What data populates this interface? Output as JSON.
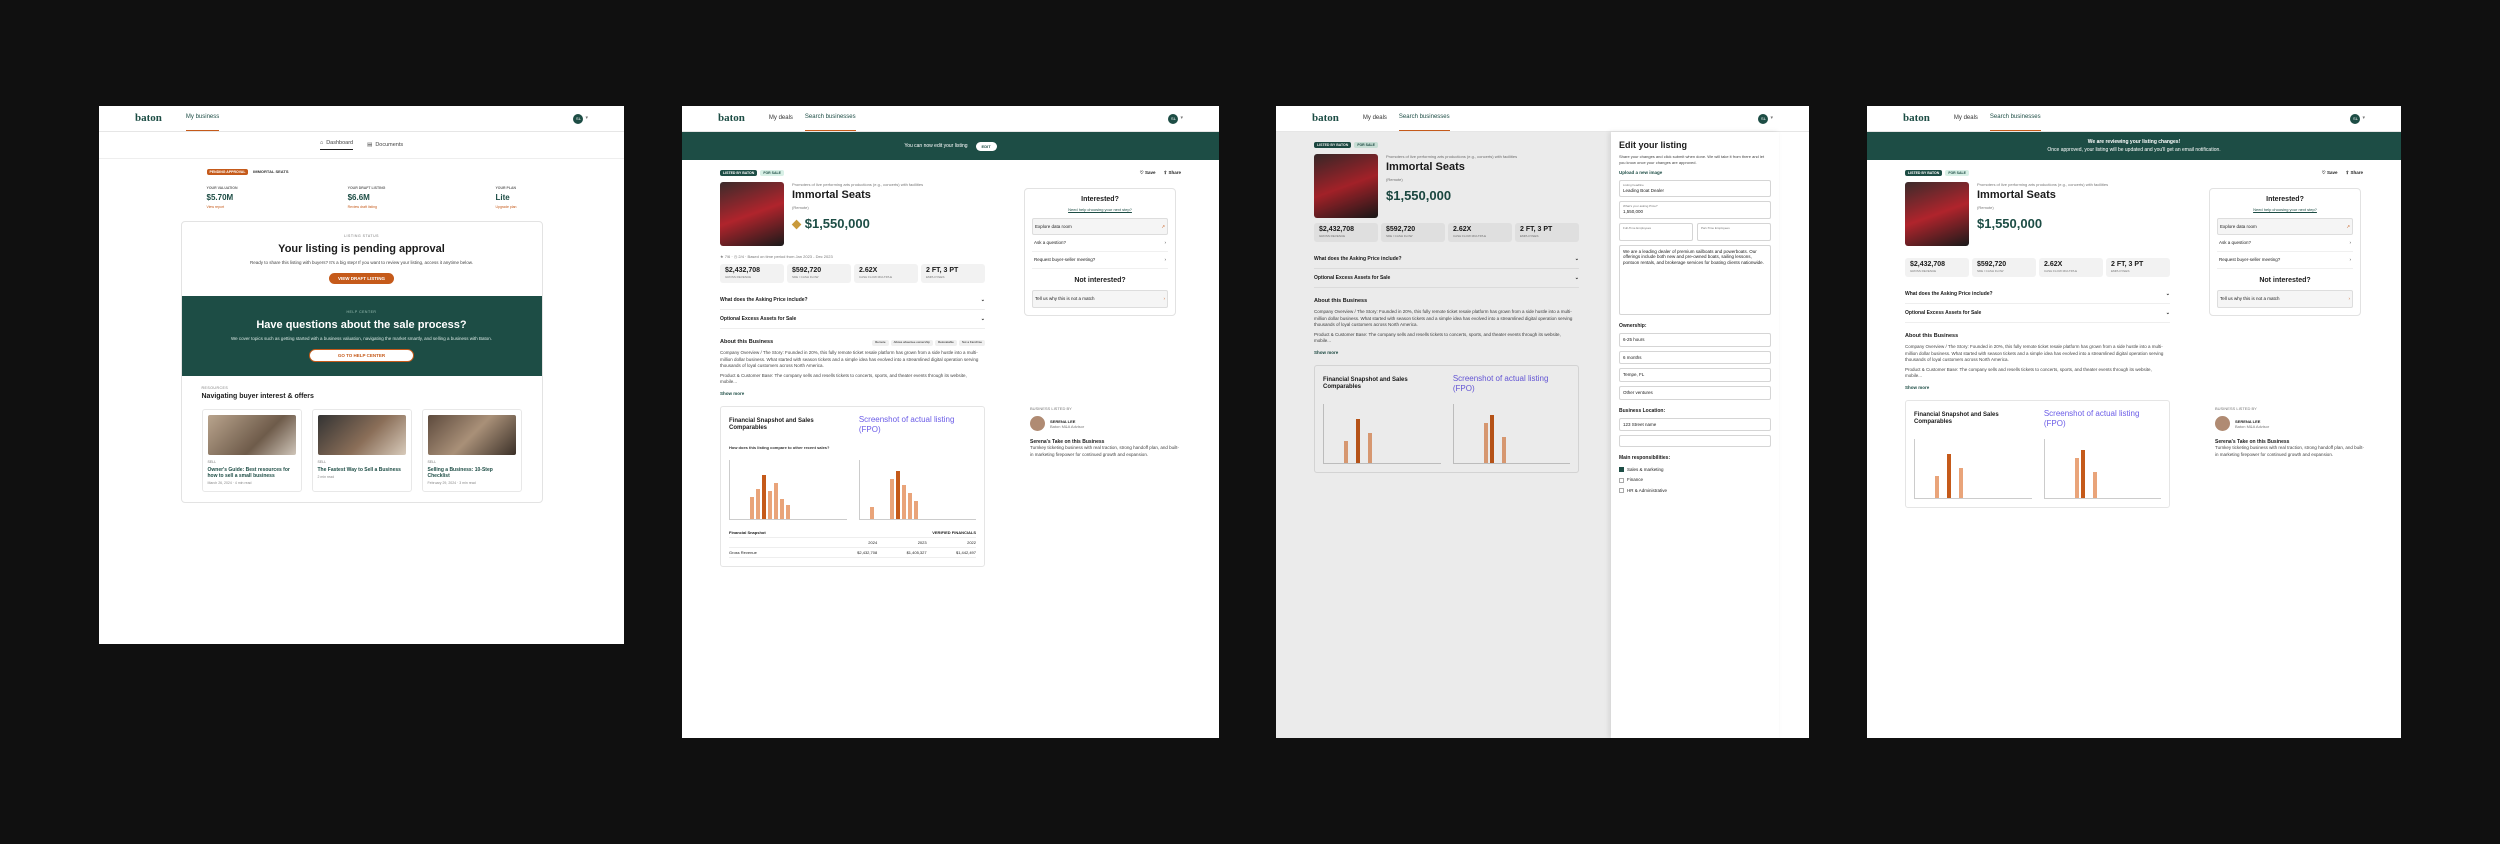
{
  "brand": "baton",
  "panel1": {
    "nav": [
      "My business"
    ],
    "tabs": [
      "Dashboard",
      "Documents"
    ],
    "badge": "PENDING APPROVAL",
    "draft_label": "IMMORTAL SEATS",
    "kpis": [
      {
        "label": "YOUR VALUATION",
        "value": "$5.70M",
        "action": "View report"
      },
      {
        "label": "YOUR DRAFT LISTING",
        "value": "$6.6M",
        "action": "Review draft listing"
      },
      {
        "label": "YOUR PLAN",
        "value": "Lite",
        "action": "Upgrade plan"
      }
    ],
    "status": {
      "eyebrow": "LISTING STATUS",
      "title": "Your listing is pending approval",
      "body": "Ready to share this listing with buyers? It's a big step! If you want to review your listing, access it anytime below.",
      "button": "VIEW DRAFT LISTING"
    },
    "help": {
      "eyebrow": "HELP CENTER",
      "title": "Have questions about the sale process?",
      "body": "We cover topics such as getting started with a business valuation, navigating the market smartly, and selling a business with Baton.",
      "button": "GO TO HELP CENTER"
    },
    "resources": {
      "eyebrow": "RESOURCES",
      "title": "Navigating buyer interest & offers",
      "articles": [
        {
          "tag": "SELL",
          "title": "Owner's Guide: Best resources for how to sell a small business",
          "date": "March 26, 2024 · 4 min read"
        },
        {
          "tag": "SELL",
          "title": "The Fastest Way to Sell a Business",
          "date": "2 min read"
        },
        {
          "tag": "SELL",
          "title": "Selling a Business: 10-Step Checklist",
          "date": "February 29, 2024 · 3 min read"
        }
      ]
    }
  },
  "panel2": {
    "nav": [
      "My deals",
      "Search businesses"
    ],
    "banner": "You can now edit your listing",
    "banner_btn": "EDIT",
    "actions": [
      "Save",
      "Share"
    ],
    "badges": [
      "LISTED BY BATON",
      "FOR SALE"
    ],
    "category": "Promoters of live performing arts productions (e.g., concerts) with facilities",
    "title": "Immortal Seats",
    "location": "(Remote)",
    "price": "$1,550,000",
    "rating": "Based on time period from Jan 2023 - Dec 2023",
    "stats": [
      {
        "v": "$2,432,708",
        "k": "GROSS REVENUE"
      },
      {
        "v": "$592,720",
        "k": "SDE / CASH FLOW"
      },
      {
        "v": "2.62X",
        "k": "CASH FLOW MULTIPLE"
      },
      {
        "v": "2 FT, 3 PT",
        "k": "EMPLOYEES"
      }
    ],
    "acc": [
      "What does the Asking Price include?",
      "Optional Excess Assets for Sale"
    ],
    "about_title": "About this Business",
    "chips": [
      "Remote",
      "Allows absentee ownership",
      "Relocatable",
      "Not a franchise"
    ],
    "about": "Company Overview / The Story: Founded in 20%, this fully remote ticket resale platform has grown from a side hustle into a multi-million dollar business. What started with season tickets and a simple idea has evolved into a streamlined digital operation serving thousands of loyal customers across North America.",
    "about2": "Product & Customer Base: The company sells and resells tickets to concerts, sports, and theater events through its website, mobile...",
    "show_more": "Show more",
    "fin_title": "Financial Snapshot and Sales Comparables",
    "fin_note": "Screenshot of actual listing (FPO)",
    "fin_q": "How does this listing compare to other recent sales?",
    "snapshot": "Financial Snapshot",
    "verified": "VERIFIED FINANCIALS",
    "years": [
      "2024",
      "2023",
      "2022"
    ],
    "row": {
      "label": "Gross Revenue",
      "values": [
        "$2,432,708",
        "$1,405,327",
        "$1,442,497"
      ]
    },
    "interested": "Interested?",
    "help_link": "Need help choosing your next step?",
    "side_rows": [
      "Explore data room",
      "Ask a question?",
      "Request buyer-seller meeting?"
    ],
    "not_interested": "Not interested?",
    "tell": "Tell us why this is not a match",
    "broker_label": "BUSINESS LISTED BY",
    "broker_name": "SERENA LEE",
    "broker_role": "Baton M&A Advisor",
    "take": "Serena's Take on this Business",
    "take_body": "Turnkey ticketing business with real traction, strong handoff plan, and built-in marketing firepower for continued growth and expansion."
  },
  "panel3": {
    "form_title": "Edit your listing",
    "form_intro": "Share your changes and click submit when done. We will take it from there and let you know once your changes are approved.",
    "upload": "Upload a new image",
    "headline_label": "Listing headline",
    "headline": "Leading Boat Dealer",
    "asking_label": "What's your asking Price?",
    "asking": "1,550,000",
    "ft_label": "Full-Time Employees",
    "pt_label": "Part-Time Employees",
    "desc": "We are a leading dealer of premium sailboats and powerboats. Our offerings include both new and pre-owned boats, sailing lessons, pontoon rentals, and brokerage services for boating clients nationwide.",
    "ownership": "Ownership:",
    "hours": "6-25 hours",
    "months": "6 months",
    "city_label": "Tempe, FL",
    "reason": "Other ventures",
    "location_h": "Business Location:",
    "address": "123 Street name",
    "resp": "Main responsibilities:",
    "resp_items": [
      "Sales & marketing",
      "Finance",
      "HR & Administrative"
    ]
  },
  "panel4": {
    "banner1": "We are reviewing your listing changes!",
    "banner2": "Once approved, your listing will be updated and you'll get an email notification."
  }
}
